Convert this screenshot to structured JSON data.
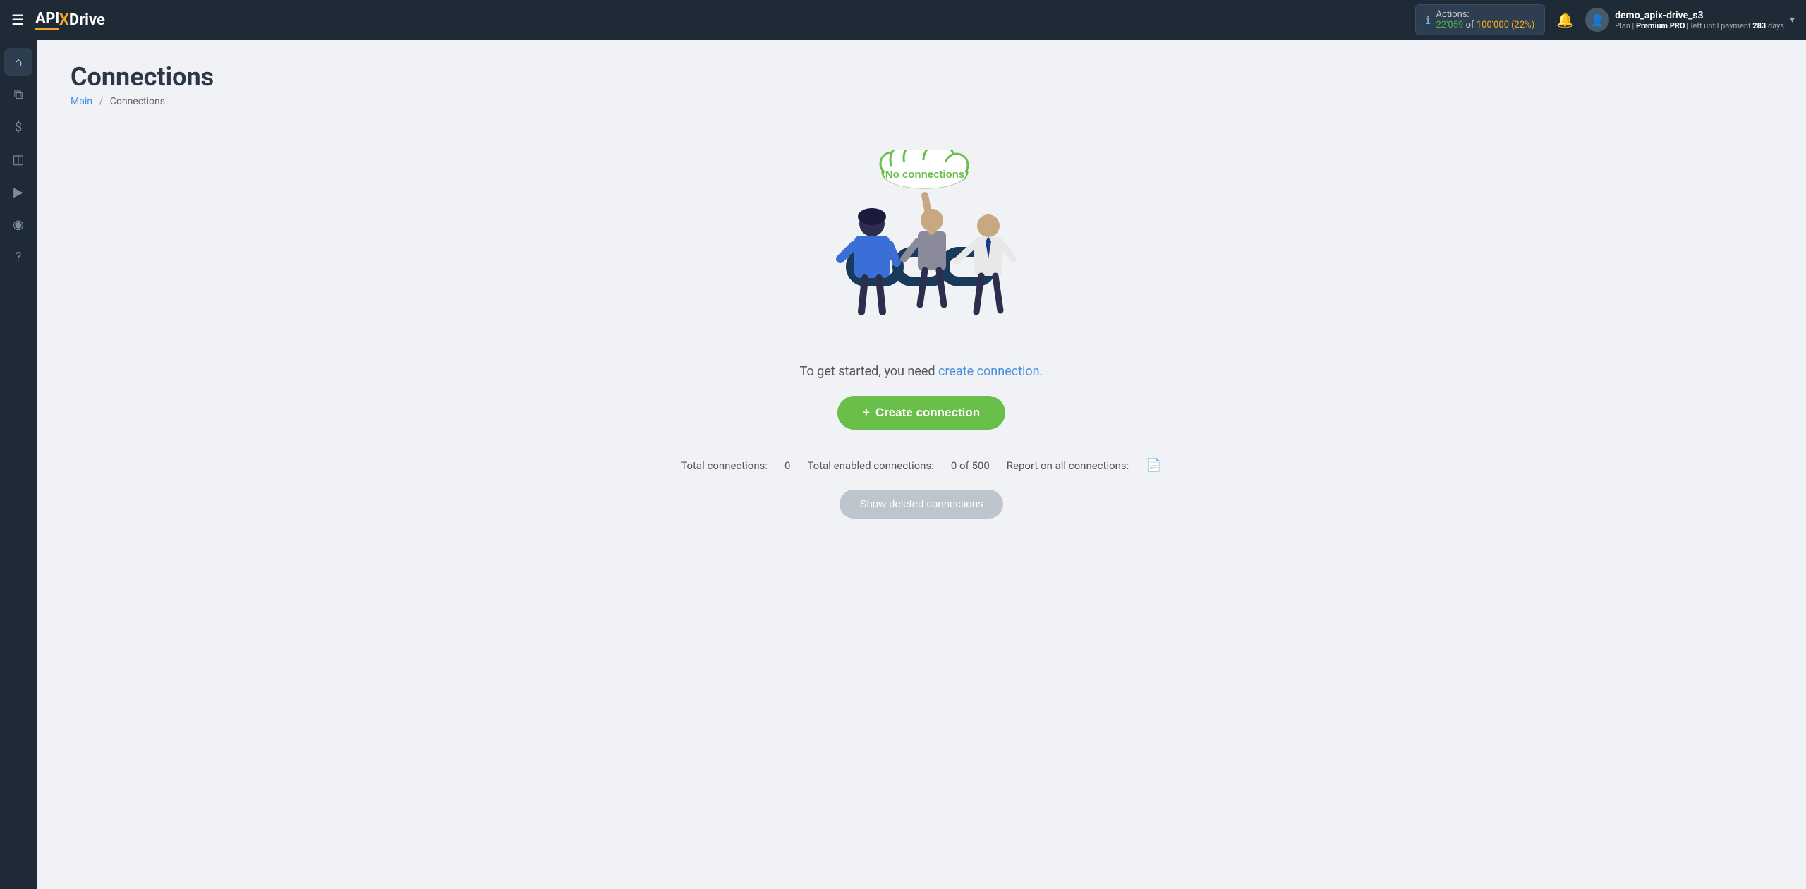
{
  "topnav": {
    "logo": {
      "api": "API",
      "x": "X",
      "drive": "Drive"
    },
    "actions": {
      "label": "Actions:",
      "used": "22'059",
      "of_text": "of",
      "total": "100'000",
      "percent": "(22%)"
    },
    "user": {
      "name": "demo_apix-drive_s3",
      "plan_label": "Plan |",
      "plan_name": "Premium PRO",
      "plan_suffix": "| left until payment",
      "days": "283",
      "days_suffix": "days"
    },
    "chevron": "▾"
  },
  "sidebar": {
    "items": [
      {
        "id": "home",
        "icon": "⌂",
        "label": "Home"
      },
      {
        "id": "connections",
        "icon": "⧉",
        "label": "Connections"
      },
      {
        "id": "billing",
        "icon": "$",
        "label": "Billing"
      },
      {
        "id": "services",
        "icon": "◫",
        "label": "Services"
      },
      {
        "id": "video",
        "icon": "▶",
        "label": "Video"
      },
      {
        "id": "account",
        "icon": "◉",
        "label": "Account"
      },
      {
        "id": "help",
        "icon": "?",
        "label": "Help"
      }
    ]
  },
  "page": {
    "title": "Connections",
    "breadcrumb": {
      "main": "Main",
      "separator": "/",
      "current": "Connections"
    }
  },
  "illustration": {
    "cloud_text": "No connections"
  },
  "main": {
    "get_started_text": "To get started, you need",
    "get_started_link": "create connection.",
    "create_button_plus": "+",
    "create_button_label": "Create connection",
    "stats": {
      "total_label": "Total connections:",
      "total_value": "0",
      "enabled_label": "Total enabled connections:",
      "enabled_value": "0 of 500",
      "report_label": "Report on all connections:"
    },
    "show_deleted_label": "Show deleted connections"
  }
}
